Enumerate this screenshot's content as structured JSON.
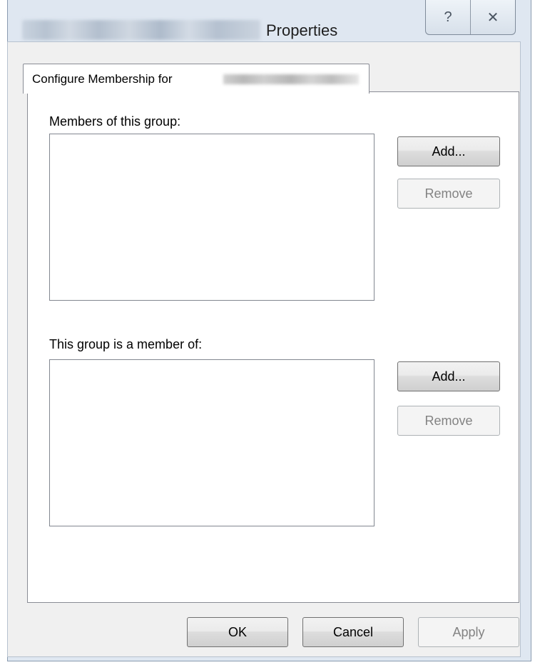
{
  "window": {
    "title": "Properties",
    "help_glyph": "?",
    "close_glyph": "✕"
  },
  "tab": {
    "label": "Configure Membership for"
  },
  "members": {
    "label": "Members of this group:",
    "add_label": "Add...",
    "remove_label": "Remove",
    "items": []
  },
  "member_of": {
    "label": "This group is a member of:",
    "add_label": "Add...",
    "remove_label": "Remove",
    "items": []
  },
  "footer": {
    "ok_label": "OK",
    "cancel_label": "Cancel",
    "apply_label": "Apply"
  }
}
